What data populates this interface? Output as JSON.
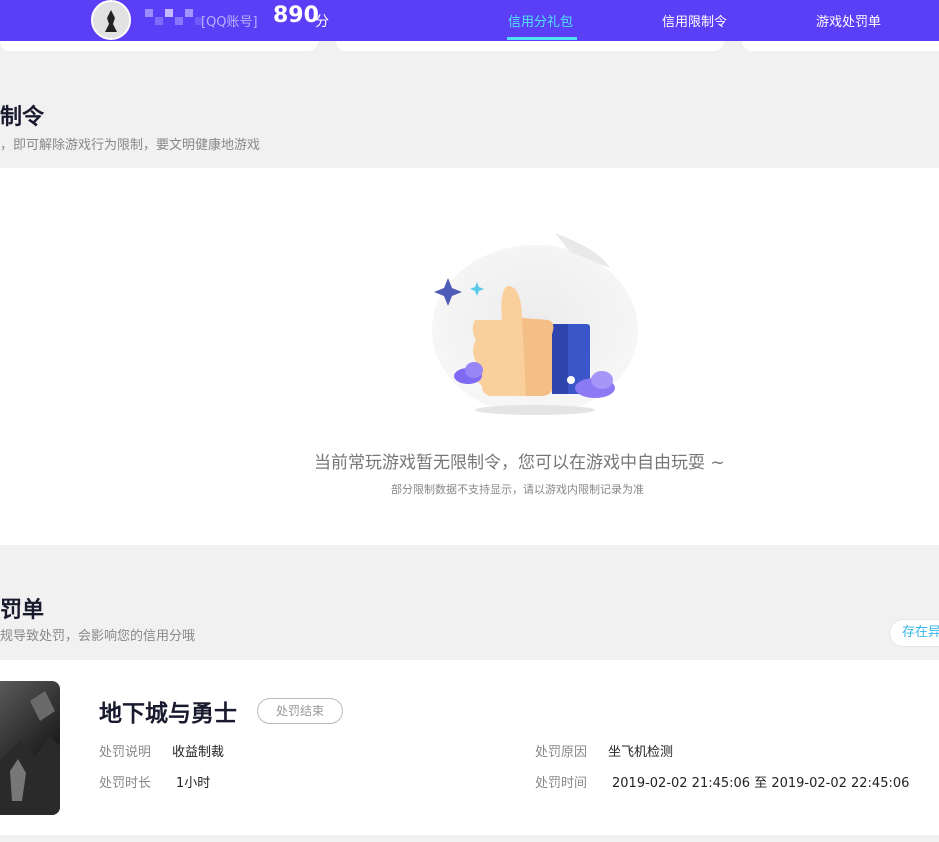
{
  "header": {
    "qq_label": "[QQ账号]",
    "score": "890",
    "score_unit": "分",
    "nav": [
      {
        "label": "信用分礼包",
        "active": true
      },
      {
        "label": "信用限制令",
        "active": false
      },
      {
        "label": "游戏处罚单",
        "active": false
      }
    ],
    "colors": {
      "bar": "#5b3ff7",
      "active": "#4fe3f5"
    }
  },
  "restriction": {
    "title": "制令",
    "subtitle": "，即可解除游戏行为限制，要文明健康地游戏",
    "empty_main": "当前常玩游戏暂无限制令，您可以在游戏中自由玩耍 ~",
    "empty_sub": "部分限制数据不支持显示，请以游戏内限制记录为准",
    "illustration_icon": "thumbs-up-icon"
  },
  "penalty": {
    "title": "罚单",
    "subtitle": "规导致处罚，会影响您的信用分哦",
    "pill_label": "存在异",
    "record": {
      "game": "地下城与勇士",
      "status": "处罚结束",
      "desc_label": "处罚说明",
      "desc_value": "收益制裁",
      "duration_label": "处罚时长",
      "duration_value": "1小时",
      "reason_label": "处罚原因",
      "reason_value": "坐飞机检测",
      "time_label": "处罚时间",
      "time_value": "2019-02-02 21:45:06 至 2019-02-02 22:45:06"
    }
  }
}
